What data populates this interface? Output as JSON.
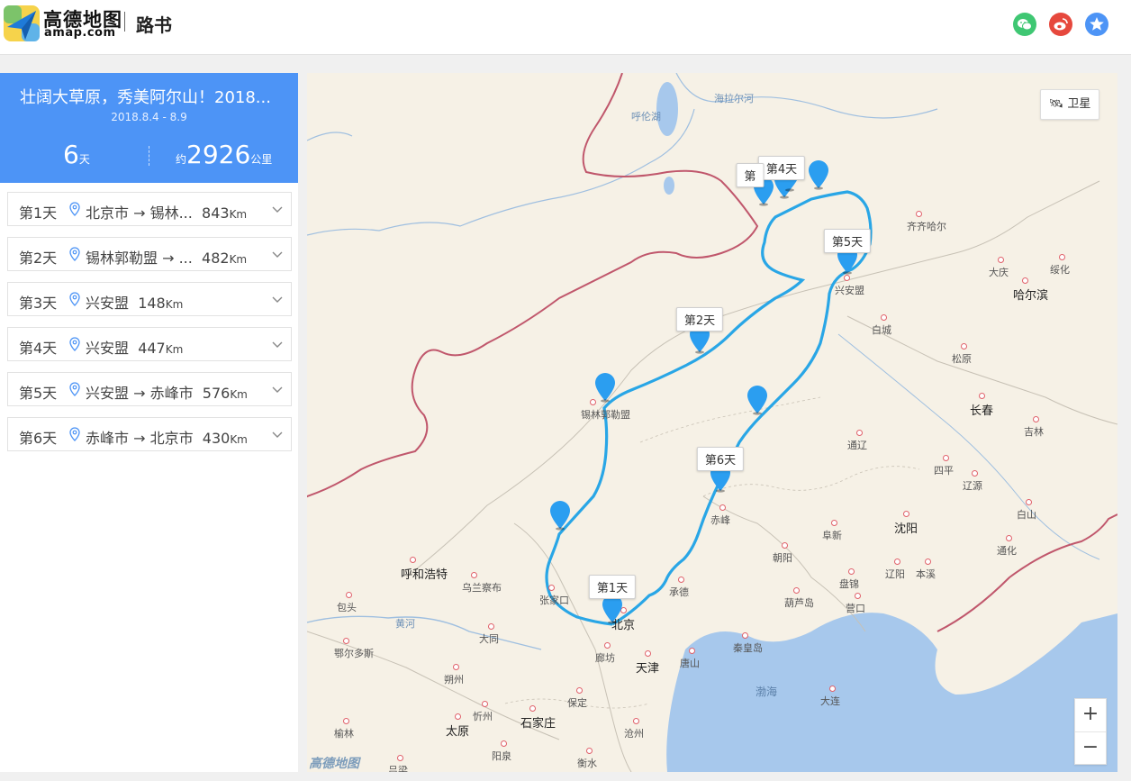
{
  "header": {
    "brand_cn": "高德地图",
    "brand_en": "amap.com",
    "section": "路书",
    "share": [
      {
        "name": "wechat-share",
        "color": "#3fc773"
      },
      {
        "name": "weibo-share",
        "color": "#e6483d"
      },
      {
        "name": "favorite-share",
        "color": "#4d94f6"
      }
    ]
  },
  "trip": {
    "title": "壮阔大草原，秀美阿尔山！2018...",
    "date": "2018.8.4 - 8.9",
    "days_value": "6",
    "days_unit": "天",
    "distance_prefix": "约",
    "distance_value": "2926",
    "distance_unit": "公里"
  },
  "days": [
    {
      "label": "第1天",
      "route": "北京市 → 锡林...",
      "km": "843",
      "unit": "Km"
    },
    {
      "label": "第2天",
      "route": "锡林郭勒盟 → ...",
      "km": "482",
      "unit": "Km"
    },
    {
      "label": "第3天",
      "route": "兴安盟",
      "km": "148",
      "unit": "Km"
    },
    {
      "label": "第4天",
      "route": "兴安盟",
      "km": "447",
      "unit": "Km"
    },
    {
      "label": "第5天",
      "route": "兴安盟 → 赤峰市",
      "km": "576",
      "unit": "Km"
    },
    {
      "label": "第6天",
      "route": "赤峰市 → 北京市",
      "km": "430",
      "unit": "Km"
    }
  ],
  "map": {
    "satellite_label": "卫星",
    "zoom_in": "+",
    "zoom_out": "−",
    "watermark": "高德地图",
    "day_tags": [
      "第1天",
      "第2天",
      "第4天",
      "第5天",
      "第6天",
      "第"
    ],
    "places": {
      "hulunhu": "呼伦湖",
      "hailaer": "海拉尔河",
      "qiqihar": "齐齐哈尔",
      "daqing": "大庆",
      "suihua": "绥化",
      "harbin": "哈尔滨",
      "xinganmeng": "兴安盟",
      "baicheng": "白城",
      "songyuan": "松原",
      "changchun": "长春",
      "jilin": "吉林",
      "xilin": "锡林郭勒盟",
      "tongliao": "通辽",
      "siping": "四平",
      "liaoyuan": "辽源",
      "baishan": "白山",
      "tonghua": "通化",
      "chifeng": "赤峰",
      "fuxin": "阜新",
      "shenyang": "沈阳",
      "liaoyang": "辽阳",
      "benxi": "本溪",
      "chaoyang": "朝阳",
      "panjin": "盘锦",
      "yingkou": "营口",
      "huludao": "葫芦岛",
      "huhehaote": "呼和浩特",
      "wulanchabu": "乌兰察布",
      "zhangjiakou": "张家口",
      "chengde": "承德",
      "beijing": "北京",
      "baotou": "包头",
      "huanghe": "黄河",
      "eerduosi": "鄂尔多斯",
      "datong": "大同",
      "shuozhou": "朔州",
      "langfang": "廊坊",
      "tianjin": "天津",
      "tangshan": "唐山",
      "qinhuangdao": "秦皇岛",
      "bohai": "渤海",
      "dalian": "大连",
      "xinzhou": "忻州",
      "baoding": "保定",
      "yulin": "榆林",
      "taiyuan": "太原",
      "shijiazhuang": "石家庄",
      "cangzhou": "沧州",
      "yangquan": "阳泉",
      "hengshui": "衡水",
      "lvliang": "吕梁"
    }
  }
}
